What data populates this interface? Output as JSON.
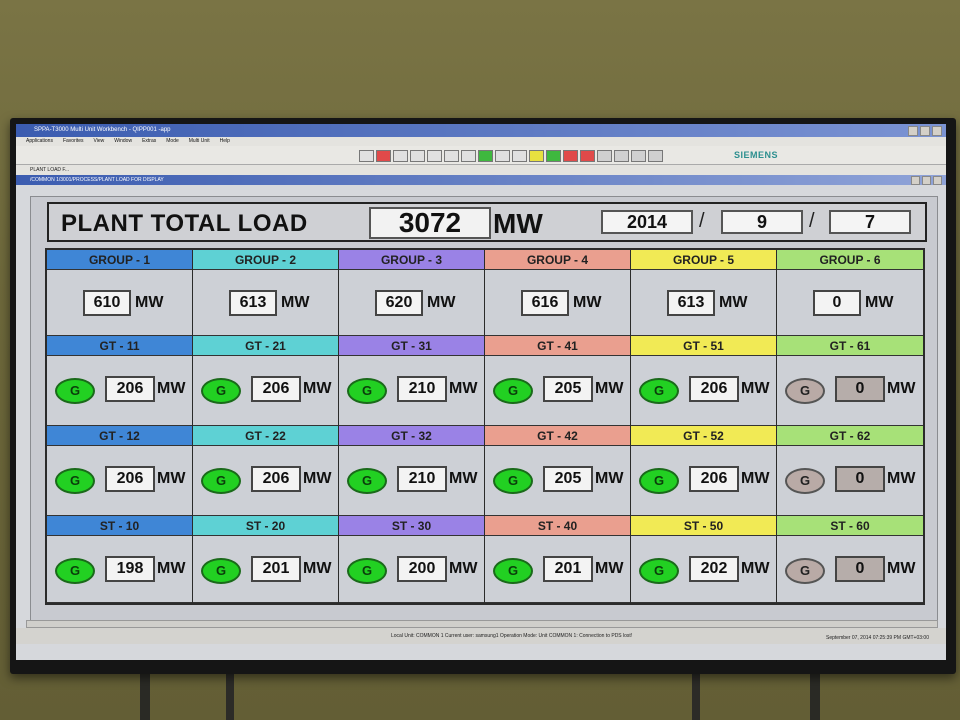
{
  "window": {
    "title": "SPPA-T3000 Multi Unit Workbench - QIPP001 -app",
    "menu": [
      "Applications",
      "Favorites",
      "View",
      "Window",
      "Extras",
      "Mode",
      "Multi Unit",
      "Help"
    ],
    "brand": "SIEMENS",
    "path": "PLANT LOAD F...",
    "subwindow_title": "/COMMON 1/3001/PROCESS/PLANT LOAD FOR DISPLAY"
  },
  "header": {
    "label": "PLANT TOTAL LOAD",
    "total": "3072",
    "unit": "MW",
    "year": "2014",
    "month": "9",
    "day": "7",
    "sep": "/"
  },
  "colors": {
    "group1": "#3f86d6",
    "group2": "#5ed1d4",
    "group3": "#9a82e6",
    "group4": "#ea9f8f",
    "group5": "#f1ea55",
    "group6": "#a7e178",
    "run": "#22d022",
    "stop": "#b9aaa6"
  },
  "unit_label": "MW",
  "columns": [
    {
      "group": "GROUP - 1",
      "group_value": "610",
      "units": [
        {
          "name": "GT - 11",
          "status": "G",
          "value": "206"
        },
        {
          "name": "GT - 12",
          "status": "G",
          "value": "206"
        },
        {
          "name": "ST - 10",
          "status": "G",
          "value": "198"
        }
      ]
    },
    {
      "group": "GROUP - 2",
      "group_value": "613",
      "units": [
        {
          "name": "GT - 21",
          "status": "G",
          "value": "206"
        },
        {
          "name": "GT - 22",
          "status": "G",
          "value": "206"
        },
        {
          "name": "ST - 20",
          "status": "G",
          "value": "201"
        }
      ]
    },
    {
      "group": "GROUP - 3",
      "group_value": "620",
      "units": [
        {
          "name": "GT - 31",
          "status": "G",
          "value": "210"
        },
        {
          "name": "GT - 32",
          "status": "G",
          "value": "210"
        },
        {
          "name": "ST - 30",
          "status": "G",
          "value": "200"
        }
      ]
    },
    {
      "group": "GROUP - 4",
      "group_value": "616",
      "units": [
        {
          "name": "GT - 41",
          "status": "G",
          "value": "205"
        },
        {
          "name": "GT - 42",
          "status": "G",
          "value": "205"
        },
        {
          "name": "ST - 40",
          "status": "G",
          "value": "201"
        }
      ]
    },
    {
      "group": "GROUP - 5",
      "group_value": "613",
      "units": [
        {
          "name": "GT - 51",
          "status": "G",
          "value": "206"
        },
        {
          "name": "GT - 52",
          "status": "G",
          "value": "206"
        },
        {
          "name": "ST - 50",
          "status": "G",
          "value": "202"
        }
      ]
    },
    {
      "group": "GROUP - 6",
      "group_value": "0",
      "units": [
        {
          "name": "GT - 61",
          "status": "G",
          "value": "0"
        },
        {
          "name": "GT - 62",
          "status": "G",
          "value": "0"
        },
        {
          "name": "ST - 60",
          "status": "G",
          "value": "0"
        }
      ]
    }
  ],
  "running": [
    true,
    true,
    true,
    true,
    true,
    false
  ],
  "statusbar": {
    "local_unit": "Local Unit: COMMON 1   Current user: samsung1   Operation Mode: Unit COMMON 1: Connection to PDS lost!",
    "datetime": "September 07, 2014 07:25:39 PM GMT+03:00"
  }
}
